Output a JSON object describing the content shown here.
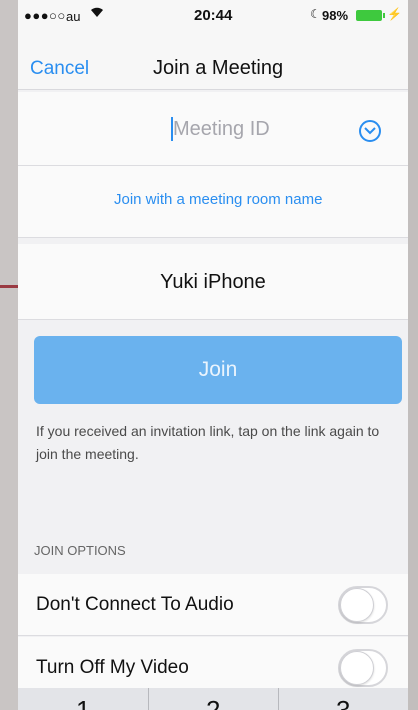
{
  "status_bar": {
    "signal": "●●●○○",
    "carrier": "au",
    "time": "20:44",
    "battery": "98%",
    "battery_color": "#3ec93e"
  },
  "nav": {
    "cancel_label": "Cancel",
    "title": "Join a Meeting"
  },
  "meeting_id": {
    "placeholder": "Meeting ID",
    "value": ""
  },
  "room_link_label": "Join with a meeting room name",
  "screen_name": {
    "value": "Yuki iPhone"
  },
  "join_label": "Join",
  "hint": "If you received an invitation link, tap on the link again to join the meeting.",
  "join_options": {
    "header": "JOIN OPTIONS",
    "items": [
      {
        "label": "Don't Connect To Audio",
        "on": false
      },
      {
        "label": "Turn Off My Video",
        "on": false
      }
    ]
  },
  "keypad": {
    "keys": [
      "1",
      "2",
      "3"
    ]
  },
  "colors": {
    "accent": "#2a8ef0",
    "join_button": "#6ab2ee"
  }
}
